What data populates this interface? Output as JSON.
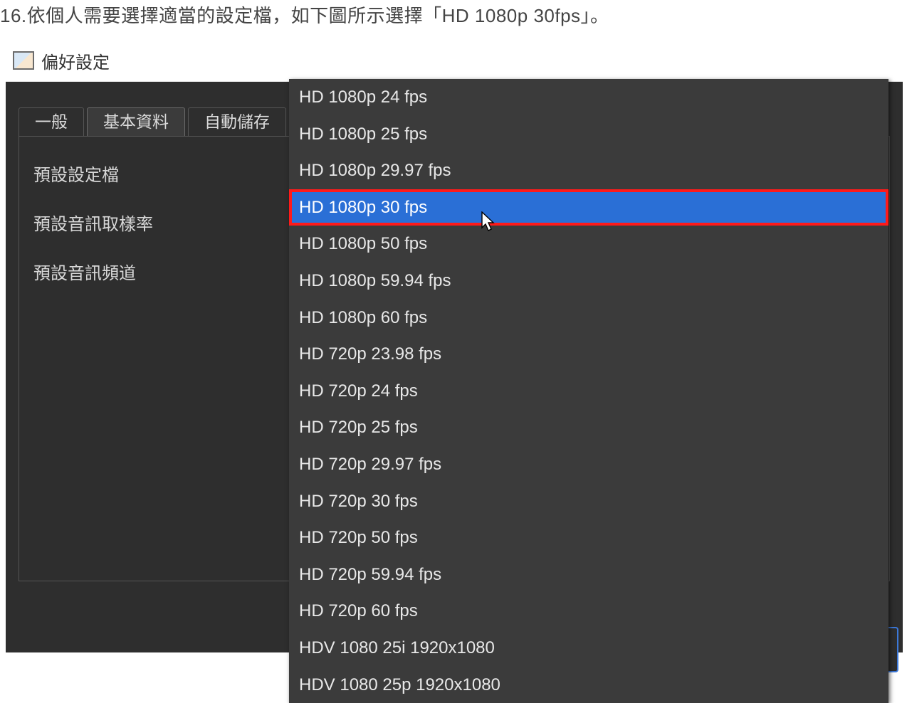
{
  "instruction": "16.依個人需要選擇適當的設定檔，如下圖所示選擇「HD 1080p 30fps」。",
  "window": {
    "title": "偏好設定"
  },
  "tabs": [
    {
      "id": "general",
      "label": "一般",
      "active": false
    },
    {
      "id": "basic",
      "label": "基本資料",
      "active": true
    },
    {
      "id": "autosave",
      "label": "自動儲存",
      "active": false
    }
  ],
  "fields": {
    "default_profile": "預設設定檔",
    "default_audio_rate": "預設音訊取樣率",
    "default_audio_channel": "預設音訊頻道"
  },
  "dropdown": {
    "selected_index": 3,
    "items": [
      "HD 1080p 24 fps",
      "HD 1080p 25 fps",
      "HD 1080p 29.97 fps",
      "HD 1080p 30 fps",
      "HD 1080p 50 fps",
      "HD 1080p 59.94 fps",
      "HD 1080p 60 fps",
      "HD 720p 23.98 fps",
      "HD 720p 24 fps",
      "HD 720p 25 fps",
      "HD 720p 29.97 fps",
      "HD 720p 30 fps",
      "HD 720p 50 fps",
      "HD 720p 59.94 fps",
      "HD 720p 60 fps",
      "HDV 1080 25i 1920x1080",
      "HDV 1080 25p 1920x1080"
    ]
  },
  "colors": {
    "highlight_bg": "#2a6fd6",
    "highlight_border": "#ff1a1a",
    "panel_bg": "#2e2e2e",
    "dropdown_bg": "#3b3b3b"
  }
}
